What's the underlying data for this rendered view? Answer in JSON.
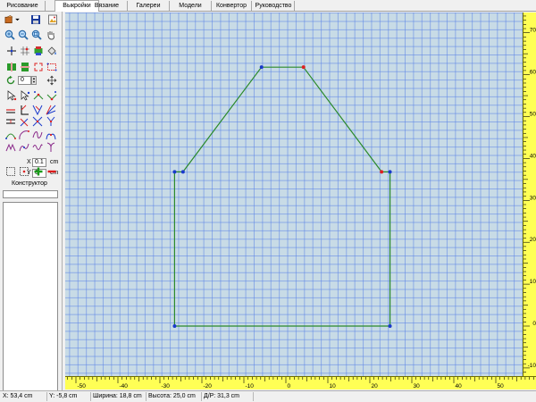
{
  "tabs": [
    {
      "label": "Рисование",
      "active": false
    },
    {
      "label": "Выкройки",
      "active": true
    },
    {
      "label": "Вязание",
      "active": false
    },
    {
      "label": "Галереи",
      "active": false
    },
    {
      "label": "Модели",
      "active": false
    },
    {
      "label": "Конвертор",
      "active": false
    },
    {
      "label": "Руководство",
      "active": false
    }
  ],
  "toolbar": {
    "rotate_value": "0",
    "x_label": "X",
    "x_value": "0.1",
    "x_unit": "cm",
    "y_label": "Y",
    "y_value": "0",
    "y_unit": "cm",
    "constructor_label": "Конструктор"
  },
  "status": {
    "x": "X: 53,4 cm",
    "y": "Y: -5,8 cm",
    "width": "Ширина: 18,8 cm",
    "height": "Высота: 25,0 cm",
    "diag": "Д/Р: 31,3 cm"
  },
  "rulers": {
    "horizontal": [
      "-50",
      "-40",
      "-30",
      "-20",
      "-10",
      "0",
      "10",
      "20",
      "30",
      "40",
      "50"
    ],
    "vertical": [
      "70",
      "60",
      "50",
      "40",
      "30",
      "20",
      "10",
      "0",
      "-10"
    ]
  },
  "shape": {
    "color": "#2a8a2a",
    "vertices": [
      {
        "x": -26.5,
        "y": 0,
        "color": "#1a3acc"
      },
      {
        "x": 24.8,
        "y": 0,
        "color": "#1a3acc"
      },
      {
        "x": 24.8,
        "y": 36.8,
        "color": "#1a3acc"
      },
      {
        "x": 22.8,
        "y": 36.8,
        "color": "#dd2222"
      },
      {
        "x": 4.2,
        "y": 61.8,
        "color": "#dd2222"
      },
      {
        "x": -5.8,
        "y": 61.8,
        "color": "#1a3acc"
      },
      {
        "x": -24.5,
        "y": 36.8,
        "color": "#1a3acc"
      },
      {
        "x": -26.5,
        "y": 36.8,
        "color": "#1a3acc"
      }
    ]
  },
  "colors": {
    "canvas_bg": "#c8dbe6",
    "grid": "#5a82e6",
    "ruler": "#ffff55"
  }
}
